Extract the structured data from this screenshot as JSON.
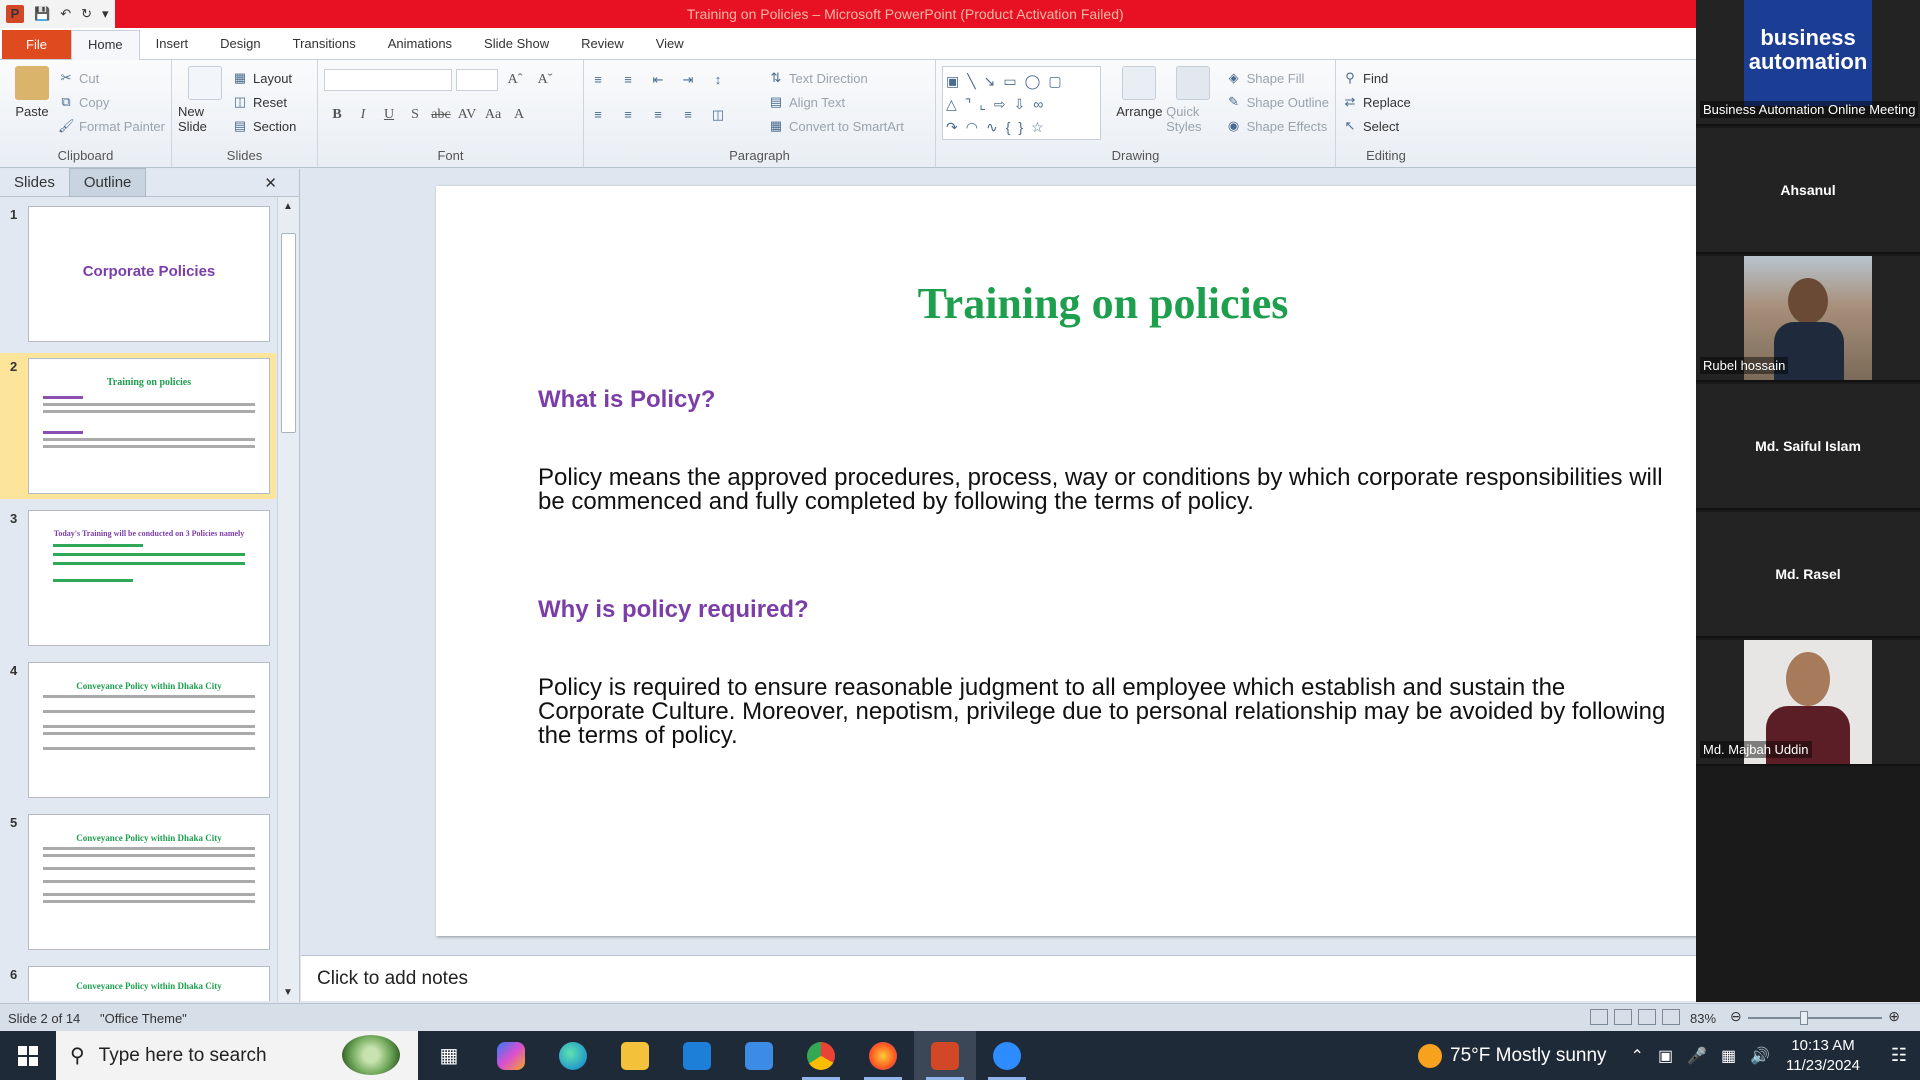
{
  "window": {
    "title": "Training on Policies – Microsoft PowerPoint (Product Activation Failed)"
  },
  "ribbon_tabs": [
    "File",
    "Home",
    "Insert",
    "Design",
    "Transitions",
    "Animations",
    "Slide Show",
    "Review",
    "View"
  ],
  "ribbon": {
    "clipboard": {
      "paste": "Paste",
      "cut": "Cut",
      "copy": "Copy",
      "format_painter": "Format Painter",
      "label": "Clipboard"
    },
    "slides": {
      "new_slide": "New Slide",
      "layout": "Layout",
      "reset": "Reset",
      "section": "Section",
      "label": "Slides"
    },
    "font": {
      "label": "Font"
    },
    "paragraph": {
      "text_direction": "Text Direction",
      "align_text": "Align Text",
      "convert_smartart": "Convert to SmartArt",
      "label": "Paragraph"
    },
    "drawing": {
      "arrange": "Arrange",
      "quick_styles": "Quick Styles",
      "shape_fill": "Shape Fill",
      "shape_outline": "Shape Outline",
      "shape_effects": "Shape Effects",
      "label": "Drawing"
    },
    "editing": {
      "find": "Find",
      "replace": "Replace",
      "select": "Select",
      "label": "Editing"
    }
  },
  "left_pane": {
    "tabs": [
      "Slides",
      "Outline"
    ],
    "close": "✕",
    "thumbnails": [
      {
        "num": "1",
        "title": "Corporate Policies"
      },
      {
        "num": "2",
        "title": "Training on policies"
      },
      {
        "num": "3",
        "title": "Today's Training will be conducted on 3 Policies namely"
      },
      {
        "num": "4",
        "title": "Conveyance Policy within Dhaka City"
      },
      {
        "num": "5",
        "title": "Conveyance Policy within Dhaka City"
      },
      {
        "num": "6",
        "title": "Conveyance Policy within Dhaka City"
      }
    ],
    "selected_index": 2
  },
  "slide": {
    "title": "Training on policies",
    "heading1": "What is Policy?",
    "body1": "Policy means the approved procedures, process, way or conditions by which corporate responsibilities will be commenced and fully completed by following the terms of policy.",
    "heading2": "Why is policy required?",
    "body2": "Policy is required to ensure reasonable judgment to all employee which establish and sustain the Corporate Culture. Moreover, nepotism, privilege due to personal relationship may be avoided by following the terms of policy."
  },
  "notes": {
    "placeholder": "Click to add notes"
  },
  "status": {
    "slide_indicator": "Slide 2 of 14",
    "theme": "\"Office Theme\"",
    "zoom": "83%",
    "zoom_fraction": 0.42
  },
  "meeting": {
    "participants": [
      {
        "name": "Business Automation Online Meeting",
        "type": "logo",
        "logo_line1": "business",
        "logo_line2": "automation"
      },
      {
        "name": "Ahsanul",
        "type": "name"
      },
      {
        "name": "Rubel hossain",
        "type": "video"
      },
      {
        "name": "Md. Saiful  Islam",
        "type": "name"
      },
      {
        "name": "Md. Rasel",
        "type": "name"
      },
      {
        "name": "Md. Majbah Uddin",
        "type": "video"
      }
    ]
  },
  "taskbar": {
    "search_placeholder": "Type here to search",
    "apps": [
      "task-view",
      "copilot",
      "edge",
      "file-explorer",
      "store",
      "mail",
      "chrome",
      "firefox",
      "powerpoint",
      "zoom"
    ],
    "weather": "75°F  Mostly sunny",
    "time": "10:13 AM",
    "date": "11/23/2024"
  },
  "colors": {
    "title_bar": "#e81123",
    "file_tab": "#e04a1f",
    "slide_title": "#1e9f4e",
    "slide_heading": "#7b3ea8",
    "selection": "#fce49a"
  }
}
